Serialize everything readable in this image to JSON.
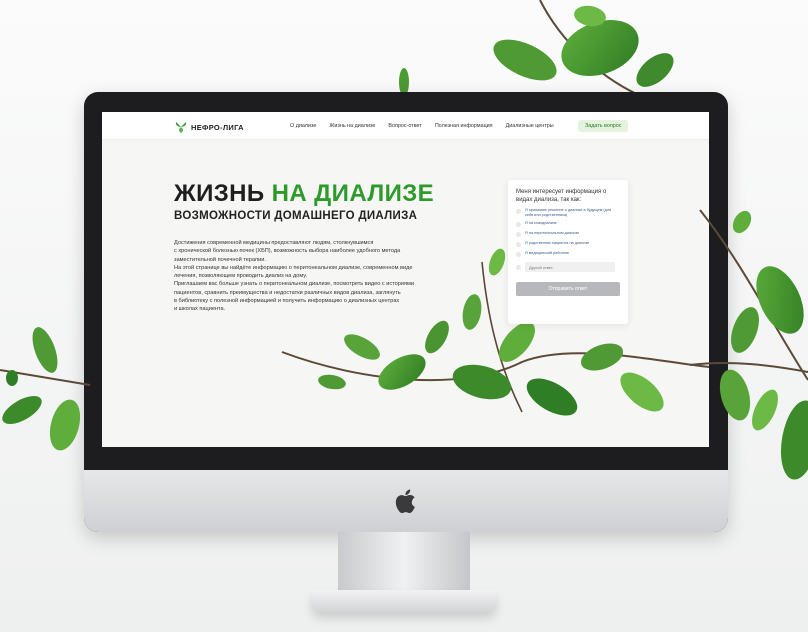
{
  "brand": {
    "logo_text": "НЕФРО-ЛИГА",
    "logo_icon": "kidney-leaf-icon",
    "accent": "#2e9a2c"
  },
  "nav": {
    "items": [
      "О диализе",
      "Жизнь на диализе",
      "Вопрос-ответ",
      "Полезная информация",
      "Диализные центры"
    ],
    "ask_button": "Задать вопрос"
  },
  "hero": {
    "title_part1": "ЖИЗНЬ",
    "title_part2": "НА ДИАЛИЗЕ",
    "subtitle": "ВОЗМОЖНОСТИ ДОМАШНЕГО ДИАЛИЗА",
    "paragraph": [
      "Достижения современной медицины предоставляют людям, столкнувшимся",
      "с хронической болезнью почек (ХБП), возможность выбора наиболее удобного метода",
      "заместительной почечной терапии.",
      "На этой странице вы найдёте информацию о перитонеальном диализе, современном виде",
      "лечения, позволяющем проводить диализ на дому.",
      "Приглашаем вас больше узнать о перитонеальном диализе, посмотреть видео с историями",
      "пациентов, сравнить преимущества и недостатки различных видов диализа, заглянуть",
      "в библиотеку с полезной информацией и получить информацию о диализных центрах",
      "и школах пациента."
    ]
  },
  "form": {
    "question": "Меня интересует информация о видах диализа, так как:",
    "options": [
      "Я принимаю решение о диализе в будущем (для себя или родственника)",
      "Я на гемодиализе",
      "Я на перитонеальном диализе",
      "Я родственник пациента на диализе",
      "Я медицинский работник"
    ],
    "other_placeholder": "Другой ответ",
    "submit": "Отправить ответ"
  },
  "device": {
    "logo_icon": "apple-logo-icon"
  }
}
